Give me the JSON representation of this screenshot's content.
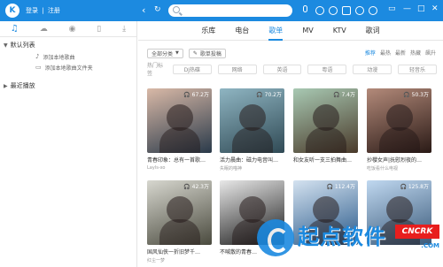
{
  "titlebar": {
    "logo_text": "K",
    "login": "登录",
    "divider": "|",
    "register": "注册"
  },
  "sidebar": {
    "default_list": "默认列表",
    "items": [
      {
        "label": "添加本地歌曲"
      },
      {
        "label": "添加本地歌曲文件夹"
      }
    ],
    "recent": "最近播放"
  },
  "topnav": {
    "tabs": [
      {
        "label": "乐库"
      },
      {
        "label": "电台"
      },
      {
        "label": "歌单",
        "active": true
      },
      {
        "label": "MV"
      },
      {
        "label": "KTV"
      },
      {
        "label": "歌词"
      }
    ]
  },
  "filters": {
    "category": "全部分类",
    "submit": "歌单投稿",
    "sort": [
      "推荐",
      "最热",
      "最新",
      "热藏",
      "飙升"
    ]
  },
  "tags": {
    "label": "热门标签",
    "items": [
      "DJ热碟",
      "网络",
      "英语",
      "粤语",
      "动漫",
      "轻音乐"
    ]
  },
  "cards": [
    {
      "plays": "67.2万",
      "title": "青春印象：总有一首歌…",
      "author": "Layls-xo",
      "color1": "#d9b9a7",
      "color2": "#2a3a4a"
    },
    {
      "plays": "70.2万",
      "title": "活力晨曲：磁力电音叫…",
      "author": "失眠的喵神",
      "color1": "#8fb5c2",
      "color2": "#304a55"
    },
    {
      "plays": "7.4万",
      "title": "和女友听一支三拍舞曲…",
      "author": "",
      "color1": "#a8c9b3",
      "color2": "#4a3a2a"
    },
    {
      "plays": "50.3万",
      "title": "抄櫻女声|抚慰烈夜的…",
      "author": "吃饭看什么电视",
      "color1": "#b38a7a",
      "color2": "#2a1a16"
    },
    {
      "plays": "42.3万",
      "title": "国风仙侠一折旧梦千…",
      "author": "红尘一梦",
      "color1": "#d7d7cf",
      "color2": "#4a4a3e"
    },
    {
      "plays": "",
      "title": "不喊散的青春…",
      "author": "",
      "color1": "#e8e8e8",
      "color2": "#1a1a1a"
    },
    {
      "plays": "112.4万",
      "title": "",
      "author": "",
      "color1": "#d4e2f0",
      "color2": "#2a5a8a"
    },
    {
      "plays": "125.8万",
      "title": "",
      "author": "",
      "color1": "#c0d8f0",
      "color2": "#3a5a7a"
    }
  ],
  "watermark": {
    "text": "起点软件",
    "badge": "CNCRK",
    "sub": ".COM"
  }
}
